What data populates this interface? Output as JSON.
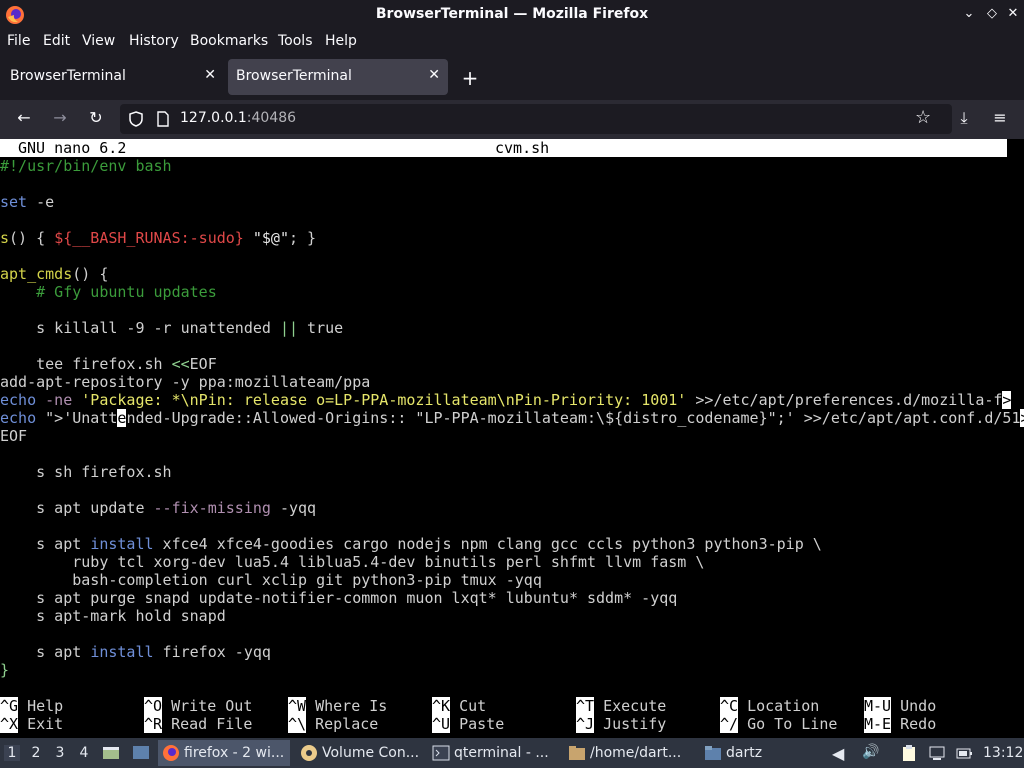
{
  "window": {
    "title": "BrowserTerminal — Mozilla Firefox"
  },
  "menu": [
    "File",
    "Edit",
    "View",
    "History",
    "Bookmarks",
    "Tools",
    "Help"
  ],
  "tabs": [
    {
      "label": "BrowserTerminal",
      "active": false
    },
    {
      "label": "BrowserTerminal",
      "active": true
    }
  ],
  "nav": {
    "url_host": "127.0.0.1",
    "url_port": ":40486"
  },
  "nano": {
    "version": "GNU nano 6.2",
    "filename": "cvm.sh"
  },
  "editor": {
    "lines": [
      "#!/usr/bin/env bash",
      "",
      "set -e",
      "",
      "s() { ${__BASH_RUNAS:-sudo} \"$@\"; }",
      "",
      "apt_cmds() {",
      "    # Gfy ubuntu updates",
      "",
      "    s killall -9 -r unattended || true",
      "",
      "    tee firefox.sh <<EOF",
      "add-apt-repository -y ppa:mozillateam/ppa",
      "echo -ne 'Package: *\\nPin: release o=LP-PPA-mozillateam\\nPin-Priority: 1001' >>/etc/apt/preferences.d/mozilla-f",
      "echo 'Unattended-Upgrade::Allowed-Origins:: \"LP-PPA-mozillateam:\\${distro_codename}\";' >>/etc/apt/apt.conf.d/51",
      "EOF",
      "",
      "    s sh firefox.sh",
      "",
      "    s apt update --fix-missing -yqq",
      "",
      "    s apt install xfce4 xfce4-goodies cargo nodejs npm clang gcc ccls python3 python3-pip \\",
      "        ruby tcl xorg-dev lua5.4 liblua5.4-dev binutils perl shfmt llvm fasm \\",
      "        bash-completion curl xclip git python3-pip tmux -yqq",
      "    s apt purge snapd update-notifier-common muon lxqt* lubuntu* sddm* -yqq",
      "    s apt-mark hold snapd",
      "",
      "    s apt install firefox -yqq",
      "}"
    ]
  },
  "shortcuts": [
    {
      "key": "^G",
      "label": "Help"
    },
    {
      "key": "^X",
      "label": "Exit"
    },
    {
      "key": "^O",
      "label": "Write Out"
    },
    {
      "key": "^R",
      "label": "Read File"
    },
    {
      "key": "^W",
      "label": "Where Is"
    },
    {
      "key": "^\\",
      "label": "Replace"
    },
    {
      "key": "^K",
      "label": "Cut"
    },
    {
      "key": "^U",
      "label": "Paste"
    },
    {
      "key": "^T",
      "label": "Execute"
    },
    {
      "key": "^J",
      "label": "Justify"
    },
    {
      "key": "^C",
      "label": "Location"
    },
    {
      "key": "^/",
      "label": "Go To Line"
    },
    {
      "key": "M-U",
      "label": "Undo"
    },
    {
      "key": "M-E",
      "label": "Redo"
    }
  ],
  "taskbar": {
    "workspaces": [
      "1",
      "2",
      "3",
      "4"
    ],
    "tasks": [
      {
        "label": "firefox - 2 wi...",
        "icon": "firefox-icon"
      },
      {
        "label": "Volume Con...",
        "icon": "volume-control-icon"
      },
      {
        "label": "qterminal - ...",
        "icon": "terminal-icon"
      },
      {
        "label": "/home/dart...",
        "icon": "folder-icon"
      },
      {
        "label": "dartz",
        "icon": "folder-icon"
      }
    ],
    "clock": "13:12"
  },
  "colors": {
    "titlebar": "#1c1b22",
    "navbar": "#2b2a33",
    "taskbar": "#2e3440",
    "accent": "#e04848"
  }
}
